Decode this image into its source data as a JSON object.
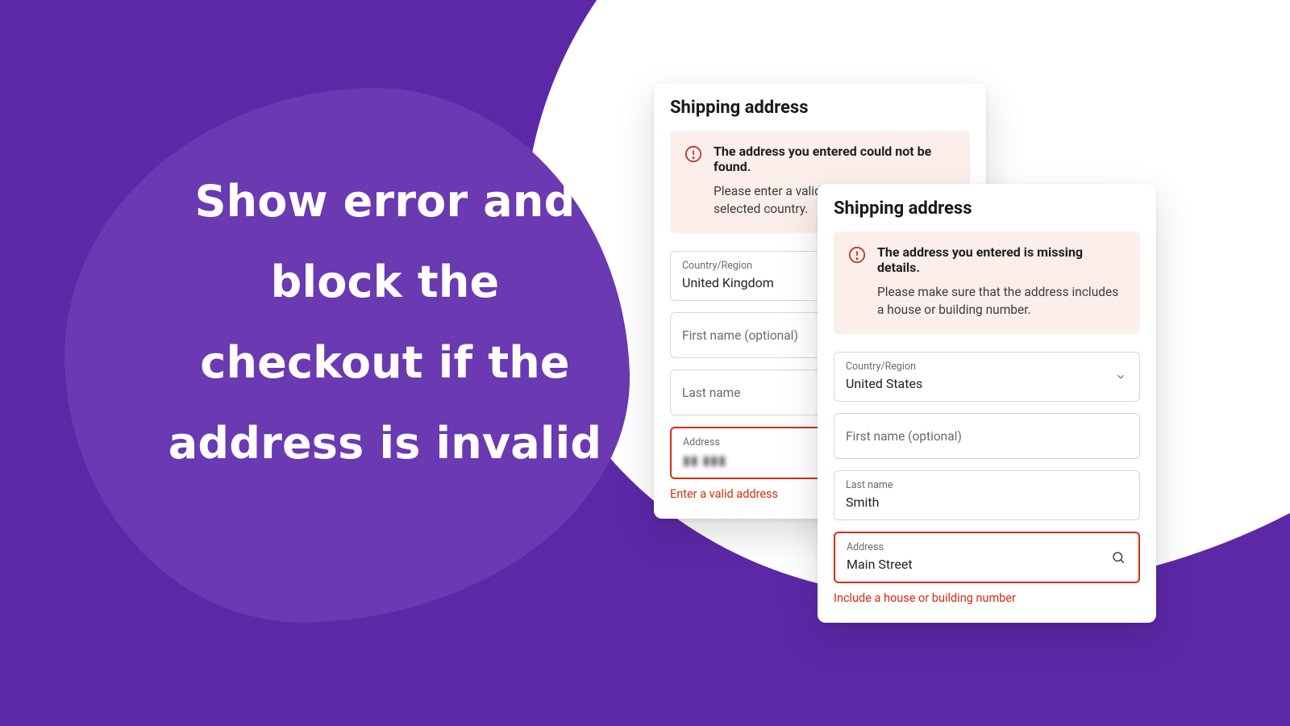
{
  "hero": {
    "text": "Show error and block the checkout if the address is invalid"
  },
  "card_a": {
    "title": "Shipping address",
    "alert": {
      "title": "The address you entered could not be found.",
      "message": "Please enter a valid address for the selected country."
    },
    "country": {
      "label": "Country/Region",
      "value": "United Kingdom"
    },
    "first_name": {
      "placeholder": "First name (optional)"
    },
    "last_name": {
      "placeholder": "Last name"
    },
    "address": {
      "label": "Address",
      "value_blurred": "▮▮  ▮▮▮"
    },
    "address_error": "Enter a valid address"
  },
  "card_b": {
    "title": "Shipping address",
    "alert": {
      "title": "The address you entered is missing details.",
      "message": "Please make sure that the address includes a house or building number."
    },
    "country": {
      "label": "Country/Region",
      "value": "United States"
    },
    "first_name": {
      "placeholder": "First name (optional)"
    },
    "last_name": {
      "label": "Last name",
      "value": "Smith"
    },
    "address": {
      "label": "Address",
      "value": "Main Street"
    },
    "address_error": "Include a house or building number"
  },
  "colors": {
    "brand_purple": "#5d28a8",
    "brand_purple_light": "#6b39b2",
    "error_red": "#d82c0d",
    "alert_bg": "#fbeeeb"
  }
}
